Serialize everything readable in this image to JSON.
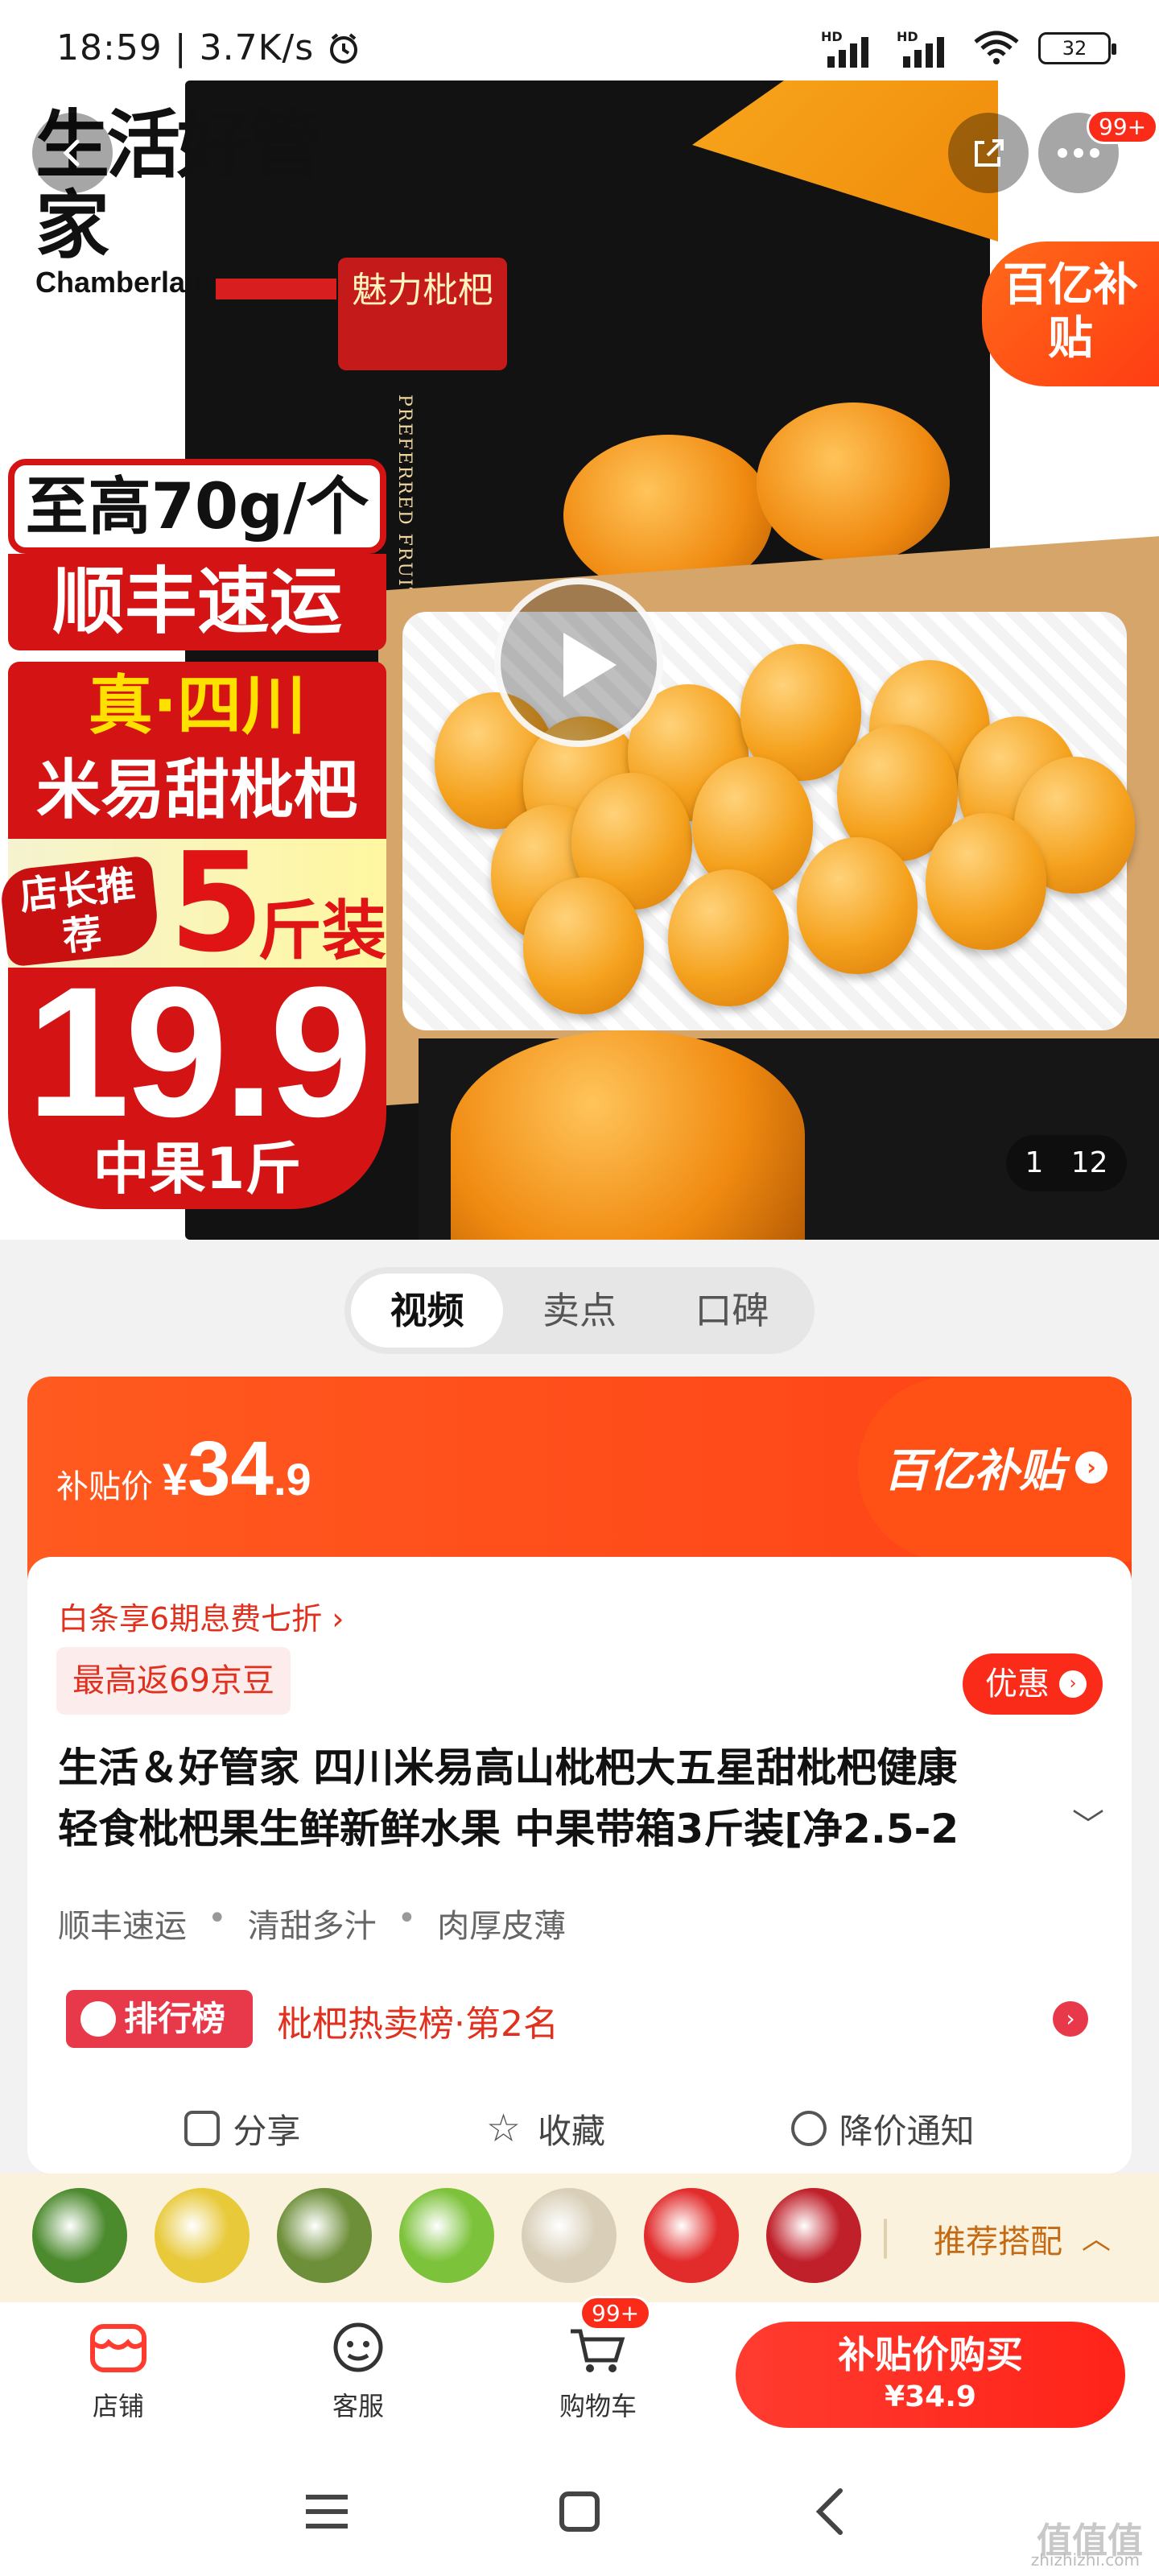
{
  "status_bar": {
    "time": "18:59 | 3.7K/s",
    "hd1": "HD",
    "hd2": "HD",
    "battery": "32"
  },
  "hero": {
    "brand_cn": "生活好管家",
    "brand_en": "Chamberlain",
    "box_title": "魅力枇杷",
    "box_english": "PREFERRED FRUIT LOQUAT",
    "subsidy_corner": "百亿补贴",
    "promo_line1": "至高70g/个",
    "promo_line2": "顺丰速运",
    "promo_line3": "真·四川",
    "promo_line4": "米易甜枇杷",
    "promo_recommend": "店长推荐",
    "promo_weight_num": "5",
    "promo_weight_unit": "斤装",
    "promo_price": "19.9",
    "promo_price_unit": "中果1斤",
    "pager_current": "1",
    "pager_total": "12",
    "more_badge": "99+"
  },
  "media_tabs": [
    {
      "label": "视频",
      "active": true
    },
    {
      "label": "卖点",
      "active": false
    },
    {
      "label": "口碑",
      "active": false
    }
  ],
  "price_card": {
    "subsidy_label": "补贴价",
    "currency": "¥",
    "price_int": "34",
    "price_dec": ".9",
    "subsidy_brand": "百亿补贴",
    "baitiao": "白条享6期息费七折 ›",
    "jingdou": "最高返69京豆",
    "coupon": "优惠",
    "title_line1": "生活＆好管家 四川米易高山枇杷大五星甜枇杷健康",
    "title_line2": "轻食枇杷果生鲜新鲜水果 中果带箱3斤装[净2.5-2",
    "tags": [
      "顺丰速运",
      "清甜多汁",
      "肉厚皮薄"
    ],
    "rank_badge": "排行榜",
    "rank_text": "枇杷热卖榜·第2名",
    "actions": [
      {
        "label": "分享",
        "icon": "share-icon"
      },
      {
        "label": "收藏",
        "icon": "star-icon"
      },
      {
        "label": "降价通知",
        "icon": "price-alert-icon"
      }
    ]
  },
  "recommend": {
    "label": "推荐搭配",
    "thumb_colors": [
      "#4c8a2e",
      "#e8c93a",
      "#6e8f3a",
      "#7cc23a",
      "#d9cfb8",
      "#e22b2b",
      "#c0202a"
    ]
  },
  "bottom_bar": {
    "shop": "店铺",
    "service": "客服",
    "cart": "购物车",
    "cart_badge": "99+",
    "buy_line1": "补贴价购买",
    "buy_line2": "¥34.9"
  },
  "watermark": {
    "main": "值值值",
    "sub": "zhizhizhi.com"
  }
}
